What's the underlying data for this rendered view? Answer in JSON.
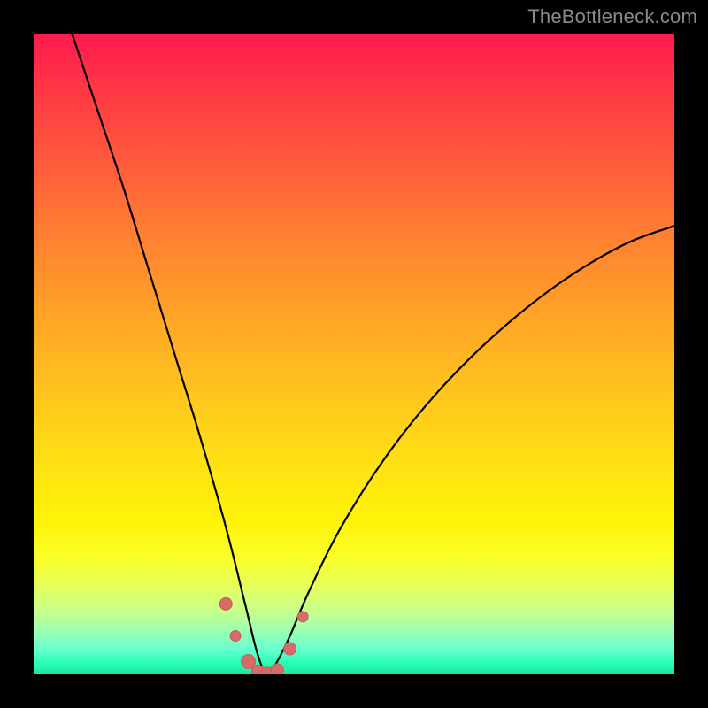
{
  "watermark": "TheBottleneck.com",
  "colors": {
    "frame": "#000000",
    "curve_stroke": "#000000",
    "marker_fill": "#d96a6a",
    "marker_stroke": "#c85a5a",
    "gradient_top": "#ff1a4f",
    "gradient_bottom": "#15e89c"
  },
  "chart_data": {
    "type": "line",
    "title": "",
    "xlabel": "",
    "ylabel": "",
    "xlim": [
      0,
      100
    ],
    "ylim": [
      0,
      100
    ],
    "grid": false,
    "legend": false,
    "note": "V-shaped bottleneck curve over a red-to-green vertical gradient. Minimum of the curve is near x≈36, y≈0. Left branch starts at top-left (x≈6, y≈100) descending steeply; right branch rises to about y≈70 at x≈100. Values estimated from pixel positions.",
    "series": [
      {
        "name": "bottleneck-curve",
        "x": [
          6,
          10,
          14,
          18,
          22,
          26,
          30,
          33,
          35,
          36.5,
          38,
          40,
          43,
          48,
          55,
          63,
          72,
          82,
          92,
          100
        ],
        "y": [
          100,
          88,
          76,
          63,
          50,
          37,
          23,
          11,
          3,
          0,
          2,
          6,
          13,
          23,
          34,
          44,
          53,
          61,
          67,
          70
        ]
      }
    ],
    "markers": {
      "name": "bottom-dots",
      "x": [
        30,
        31.5,
        33.5,
        35,
        36.5,
        38,
        40,
        42
      ],
      "y": [
        11,
        6,
        2,
        0.5,
        0,
        0.7,
        4,
        9
      ],
      "r": [
        7,
        6,
        8,
        7,
        8,
        7,
        7,
        6
      ]
    }
  }
}
